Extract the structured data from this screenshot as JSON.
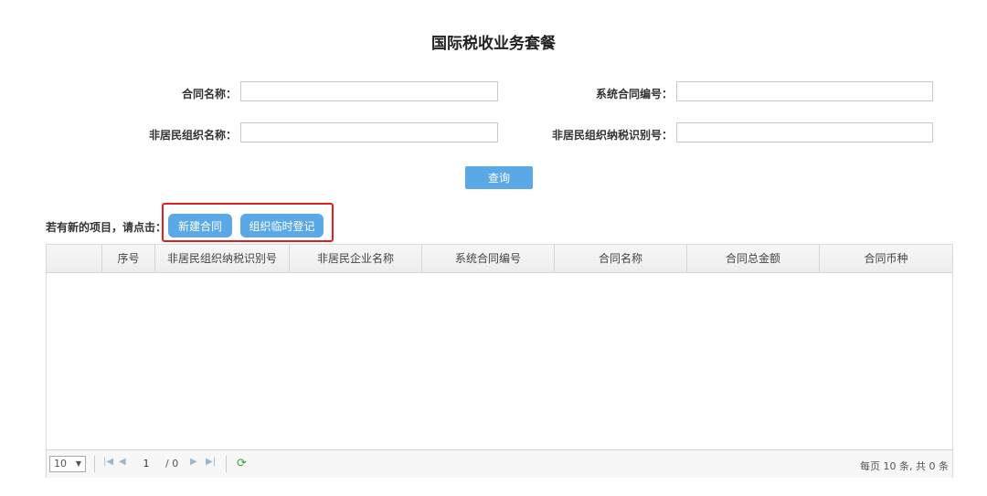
{
  "title": "国际税收业务套餐",
  "form": {
    "contract_name_label": "合同名称：",
    "contract_name_value": "",
    "system_contract_no_label": "系统合同编号：",
    "system_contract_no_value": "",
    "nonresident_org_name_label": "非居民组织名称：",
    "nonresident_org_name_value": "",
    "nonresident_org_taxid_label": "非居民组织纳税识别号：",
    "nonresident_org_taxid_value": ""
  },
  "query_button": "查询",
  "new_project_label": "若有新的项目，请点击：",
  "new_contract_button": "新建合同",
  "temp_register_button": "组织临时登记",
  "table": {
    "columns": [
      "",
      "序号",
      "非居民组织纳税识别号",
      "非居民企业名称",
      "系统合同编号",
      "合同名称",
      "合同总金额",
      "合同币种"
    ],
    "rows": []
  },
  "pager": {
    "page_size": "10",
    "current_page": "1",
    "total_pages": "/ 0",
    "info": "每页 10 条, 共 0 条"
  }
}
